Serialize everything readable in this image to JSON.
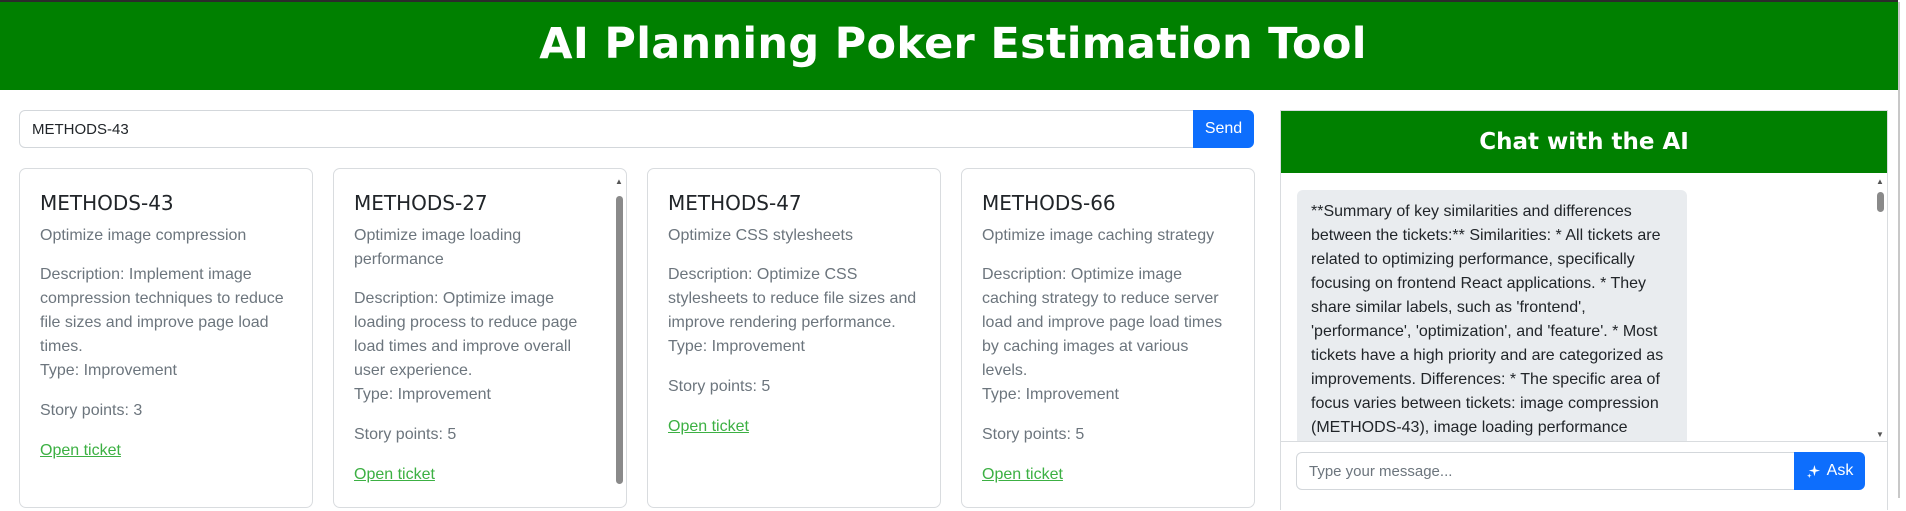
{
  "app": {
    "title": "AI Planning Poker Estimation Tool"
  },
  "search": {
    "value": "METHODS-43",
    "send_label": "Send"
  },
  "tickets": [
    {
      "key": "METHODS-43",
      "summary": "Optimize image compression",
      "description": "Description: Implement image compression techniques to reduce file sizes and improve page load times.",
      "type": "Type: Improvement",
      "points": "Story points: 3",
      "link": "Open ticket"
    },
    {
      "key": "METHODS-27",
      "summary": "Optimize image loading performance",
      "description": "Description: Optimize image loading process to reduce page load times and improve overall user experience.",
      "type": "Type: Improvement",
      "points": "Story points: 5",
      "link": "Open ticket"
    },
    {
      "key": "METHODS-47",
      "summary": "Optimize CSS stylesheets",
      "description": "Description: Optimize CSS stylesheets to reduce file sizes and improve rendering performance.",
      "type": "Type: Improvement",
      "points": "Story points: 5",
      "link": "Open ticket"
    },
    {
      "key": "METHODS-66",
      "summary": "Optimize image caching strategy",
      "description": "Description: Optimize image caching strategy to reduce server load and improve page load times by caching images at various levels.",
      "type": "Type: Improvement",
      "points": "Story points: 5",
      "link": "Open ticket"
    }
  ],
  "chat": {
    "title": "Chat with the AI",
    "messages": [
      {
        "role": "ai",
        "text": "**Summary of key similarities and differences between the tickets:** Similarities: * All tickets are related to optimizing performance, specifically focusing on frontend React applications. * They share similar labels, such as 'frontend', 'performance', 'optimization', and 'feature'. * Most tickets have a high priority and are categorized as improvements. Differences: * The specific area of focus varies between tickets: image compression (METHODS-43), image loading performance"
      }
    ],
    "input_placeholder": "Type your message...",
    "ask_label": "Ask"
  },
  "colors": {
    "brand": "#008000",
    "primary": "#0d6efd",
    "link": "#3cb043",
    "muted": "#6c757d",
    "bubble": "#e9ecef"
  },
  "icons": {
    "ask": "sparkles-icon"
  }
}
